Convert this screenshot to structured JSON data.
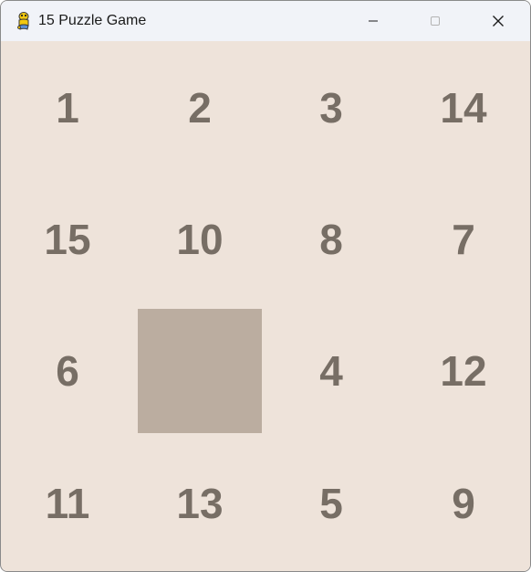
{
  "window": {
    "title": "15 Puzzle Game",
    "app_icon": "pygame-snake-icon",
    "controls": {
      "minimize_icon": "minimize-icon",
      "maximize_icon": "maximize-icon",
      "close_icon": "close-icon"
    }
  },
  "colors": {
    "board_background": "#eee3da",
    "empty_tile": "#bbada0",
    "tile_text": "#776e65",
    "titlebar": "#f1f3f8"
  },
  "board": {
    "size": 4,
    "tiles": [
      {
        "label": "1"
      },
      {
        "label": "2"
      },
      {
        "label": "3"
      },
      {
        "label": "14"
      },
      {
        "label": "15"
      },
      {
        "label": "10"
      },
      {
        "label": "8"
      },
      {
        "label": "7"
      },
      {
        "label": "6"
      },
      {
        "label": ""
      },
      {
        "label": "4"
      },
      {
        "label": "12"
      },
      {
        "label": "11"
      },
      {
        "label": "13"
      },
      {
        "label": "5"
      },
      {
        "label": "9"
      }
    ]
  }
}
